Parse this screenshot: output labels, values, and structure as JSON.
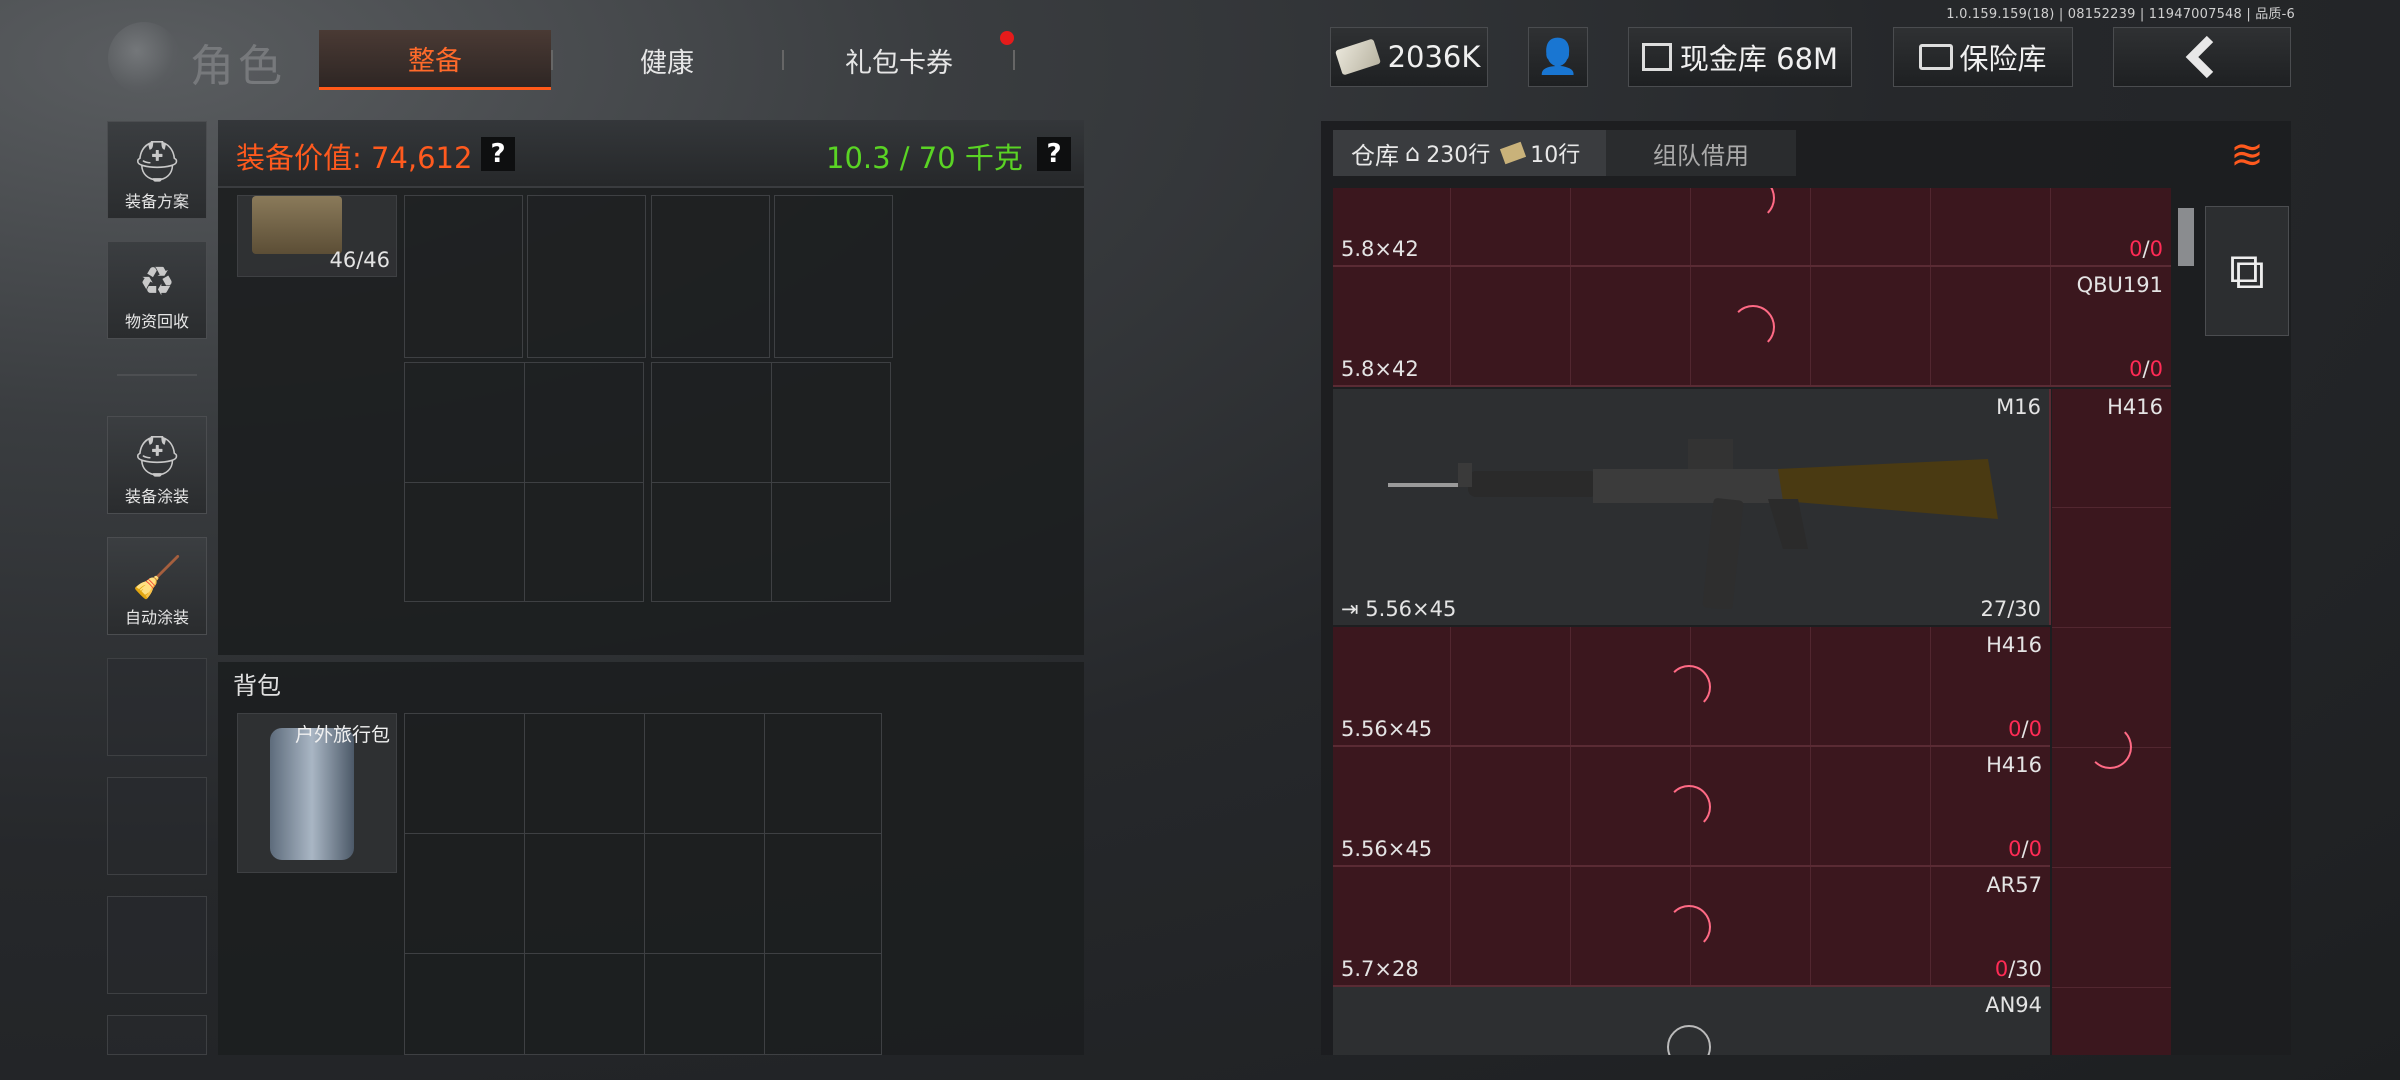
{
  "version": "1.0.159.159(18) | 08152239 | 11947007548 | 品质-6",
  "header": {
    "title": "角色",
    "tabs": [
      {
        "label": "整备",
        "active": true
      },
      {
        "label": "健康",
        "active": false
      },
      {
        "label": "礼包卡券",
        "active": false,
        "badge": "red-dot"
      }
    ],
    "currency": "2036K",
    "cash_vault": "现金库 68M",
    "safe_vault": "保险库"
  },
  "rail": {
    "items": [
      {
        "label": "装备方案",
        "icon": "helmet-grid-icon"
      },
      {
        "label": "物资回收",
        "icon": "recycle-icon"
      },
      {
        "label": "装备涂装",
        "icon": "helmet-paint-icon"
      },
      {
        "label": "自动涂装",
        "icon": "brush-gear-icon"
      }
    ]
  },
  "loadout": {
    "value_label": "装备价值: 74,612",
    "weight_label": "10.3 / 70 千克",
    "help": "?",
    "vest_durability": "46/46",
    "backpack_section": "背包",
    "backpack_name": "户外旅行包"
  },
  "warehouse": {
    "tab_label": "仓库",
    "rows_main": "230行",
    "rows_extra": "10行",
    "team_tab": "组队借用",
    "slots": [
      {
        "caliber": "5.8×42",
        "name": "",
        "ammo_cur": "0",
        "ammo_max": "0"
      },
      {
        "caliber": "5.8×42",
        "name": "QBU191",
        "ammo_cur": "0",
        "ammo_max": "0"
      },
      {
        "caliber": "5.56×45",
        "name": "M16",
        "ammo_cur": "27",
        "ammo_max": "30"
      },
      {
        "caliber": "5.56×45",
        "name": "H416",
        "ammo_cur": "0",
        "ammo_max": "0"
      },
      {
        "caliber": "5.56×45",
        "name": "H416",
        "ammo_cur": "0",
        "ammo_max": "0"
      },
      {
        "caliber": "5.7×28",
        "name": "AR57",
        "ammo_cur": "0",
        "ammo_max": "30"
      },
      {
        "caliber": "",
        "name": "AN94",
        "ammo_cur": "",
        "ammo_max": ""
      }
    ],
    "side_slot_name": "H416"
  }
}
